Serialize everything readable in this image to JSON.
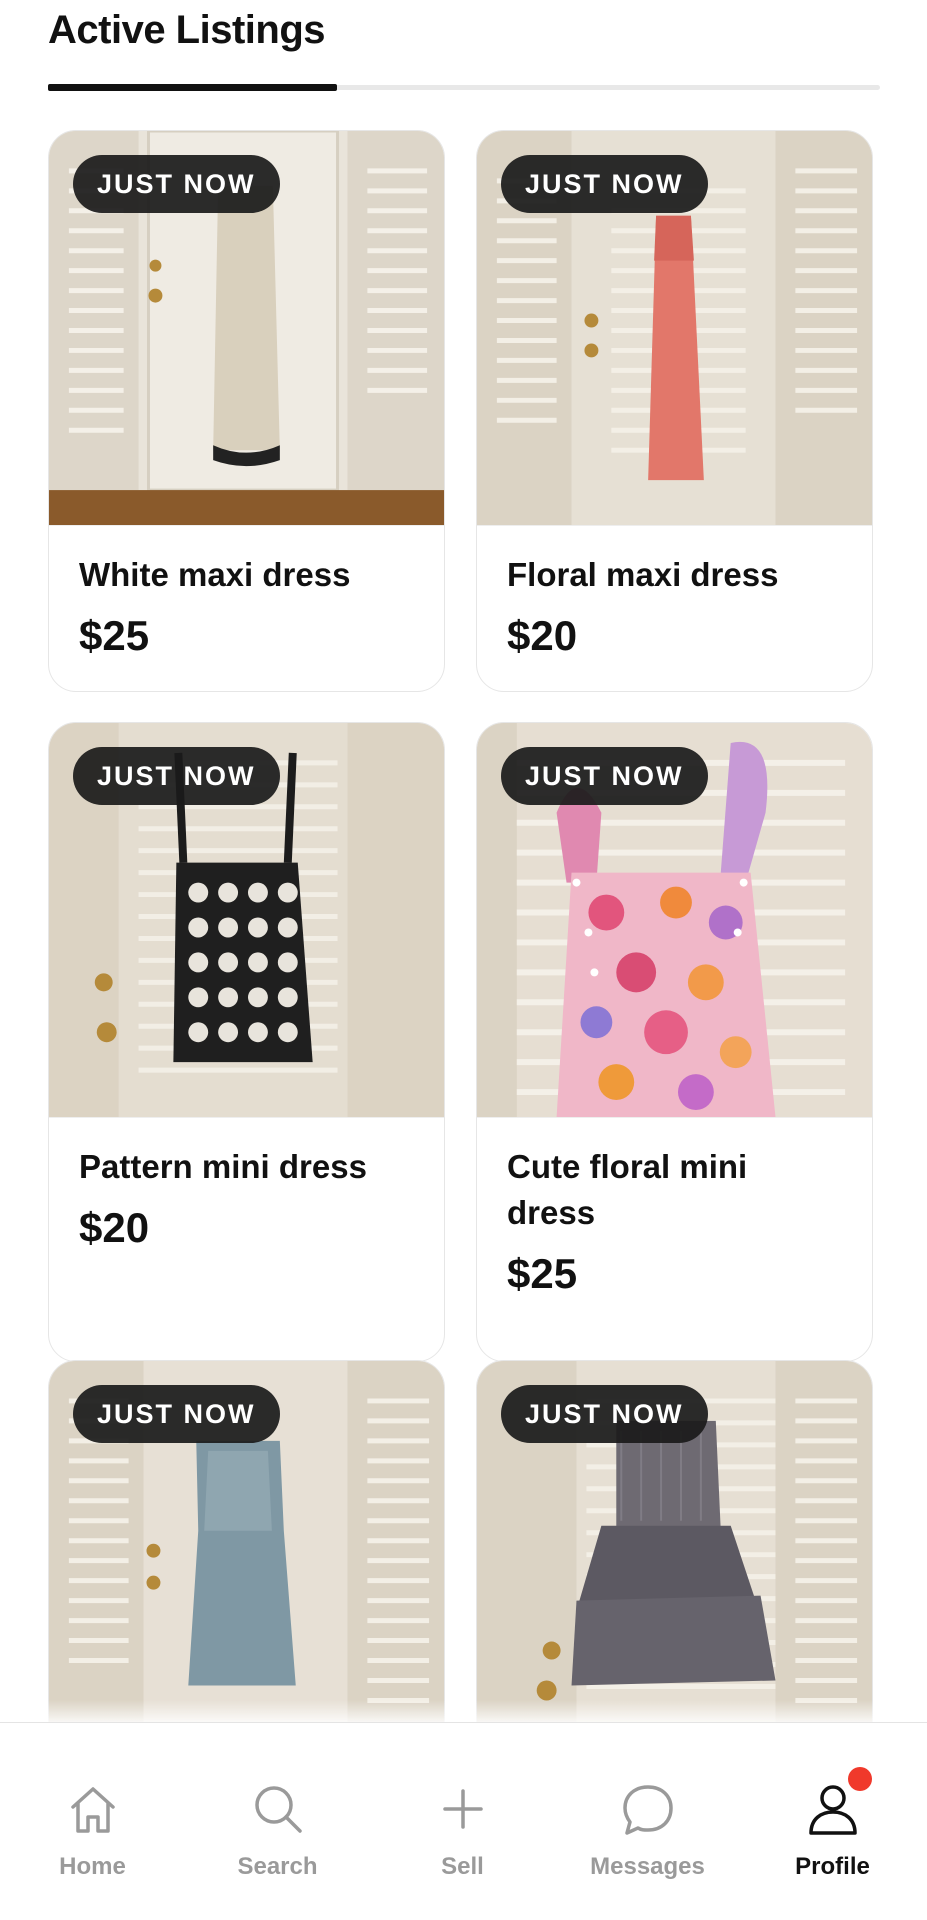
{
  "header": {
    "title": "Active Listings"
  },
  "listings": [
    {
      "badge": "JUST NOW",
      "title": "White maxi dress",
      "price": "$25",
      "image": "white-crochet-maxi-dress-photo"
    },
    {
      "badge": "JUST NOW",
      "title": "Floral maxi dress",
      "price": "$20",
      "image": "pink-floral-maxi-dress-photo"
    },
    {
      "badge": "JUST NOW",
      "title": "Pattern mini dress",
      "price": "$20",
      "image": "black-white-pattern-mini-dress-photo"
    },
    {
      "badge": "JUST NOW",
      "title": "Cute floral mini dress",
      "price": "$25",
      "image": "floral-ruffle-mini-dress-photo"
    },
    {
      "badge": "JUST NOW",
      "title": "",
      "price": "",
      "image": "denim-maxi-skirt-photo"
    },
    {
      "badge": "JUST NOW",
      "title": "",
      "price": "",
      "image": "gingham-tiered-skirt-photo"
    }
  ],
  "tabbar": {
    "items": [
      {
        "label": "Home",
        "icon": "home-icon"
      },
      {
        "label": "Search",
        "icon": "search-icon"
      },
      {
        "label": "Sell",
        "icon": "plus-icon"
      },
      {
        "label": "Messages",
        "icon": "chat-bubble-icon"
      },
      {
        "label": "Profile",
        "icon": "person-icon",
        "active": true,
        "notification": true
      }
    ]
  },
  "colors": {
    "accent": "#111111",
    "inactive": "#9a9a9a",
    "notification": "#f0392b",
    "badge_bg": "#1a1a1a"
  }
}
